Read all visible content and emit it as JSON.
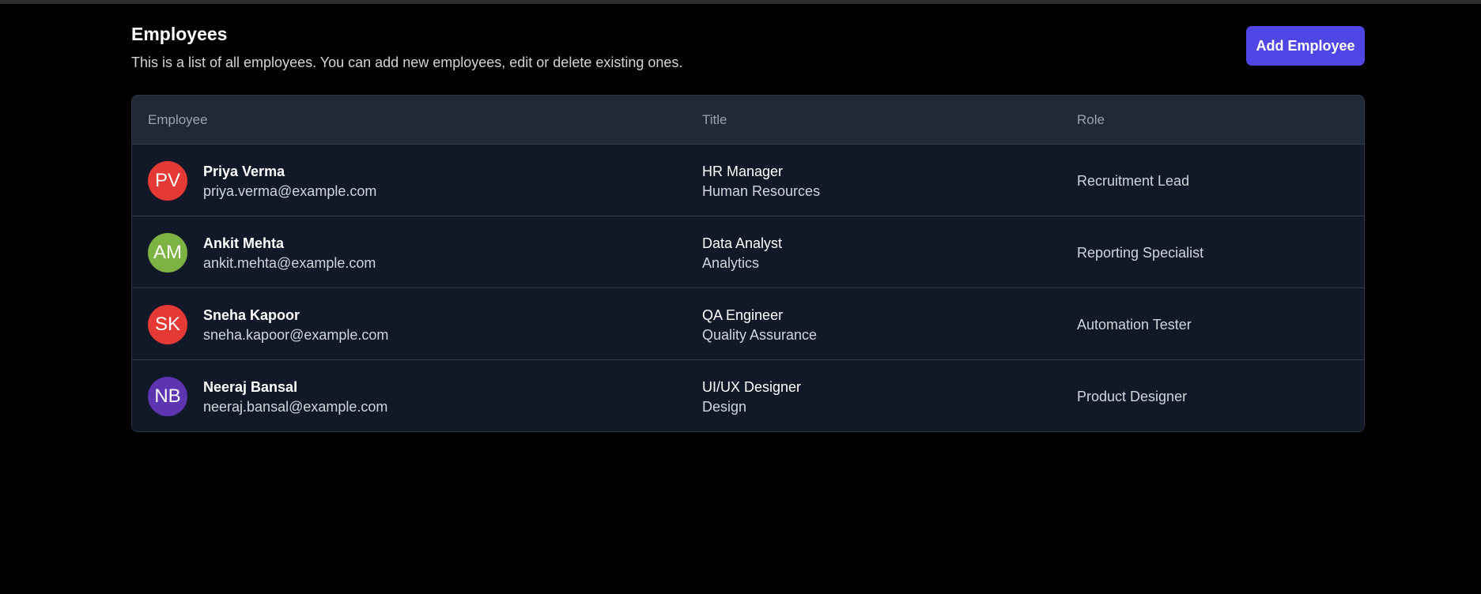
{
  "header": {
    "title": "Employees",
    "description": "This is a list of all employees. You can add new employees, edit or delete existing ones.",
    "add_button_label": "Add Employee",
    "add_button_color": "#4f46e5"
  },
  "table": {
    "columns": [
      "Employee",
      "Title",
      "Role"
    ],
    "rows": [
      {
        "initials": "PV",
        "avatar_color": "#e53935",
        "name": "Priya Verma",
        "email": "priya.verma@example.com",
        "title": "HR Manager",
        "department": "Human Resources",
        "role": "Recruitment Lead"
      },
      {
        "initials": "AM",
        "avatar_color": "#7cb342",
        "name": "Ankit Mehta",
        "email": "ankit.mehta@example.com",
        "title": "Data Analyst",
        "department": "Analytics",
        "role": "Reporting Specialist"
      },
      {
        "initials": "SK",
        "avatar_color": "#e53935",
        "name": "Sneha Kapoor",
        "email": "sneha.kapoor@example.com",
        "title": "QA Engineer",
        "department": "Quality Assurance",
        "role": "Automation Tester"
      },
      {
        "initials": "NB",
        "avatar_color": "#5e35b1",
        "name": "Neeraj Bansal",
        "email": "neeraj.bansal@example.com",
        "title": "UI/UX Designer",
        "department": "Design",
        "role": "Product Designer"
      }
    ]
  }
}
